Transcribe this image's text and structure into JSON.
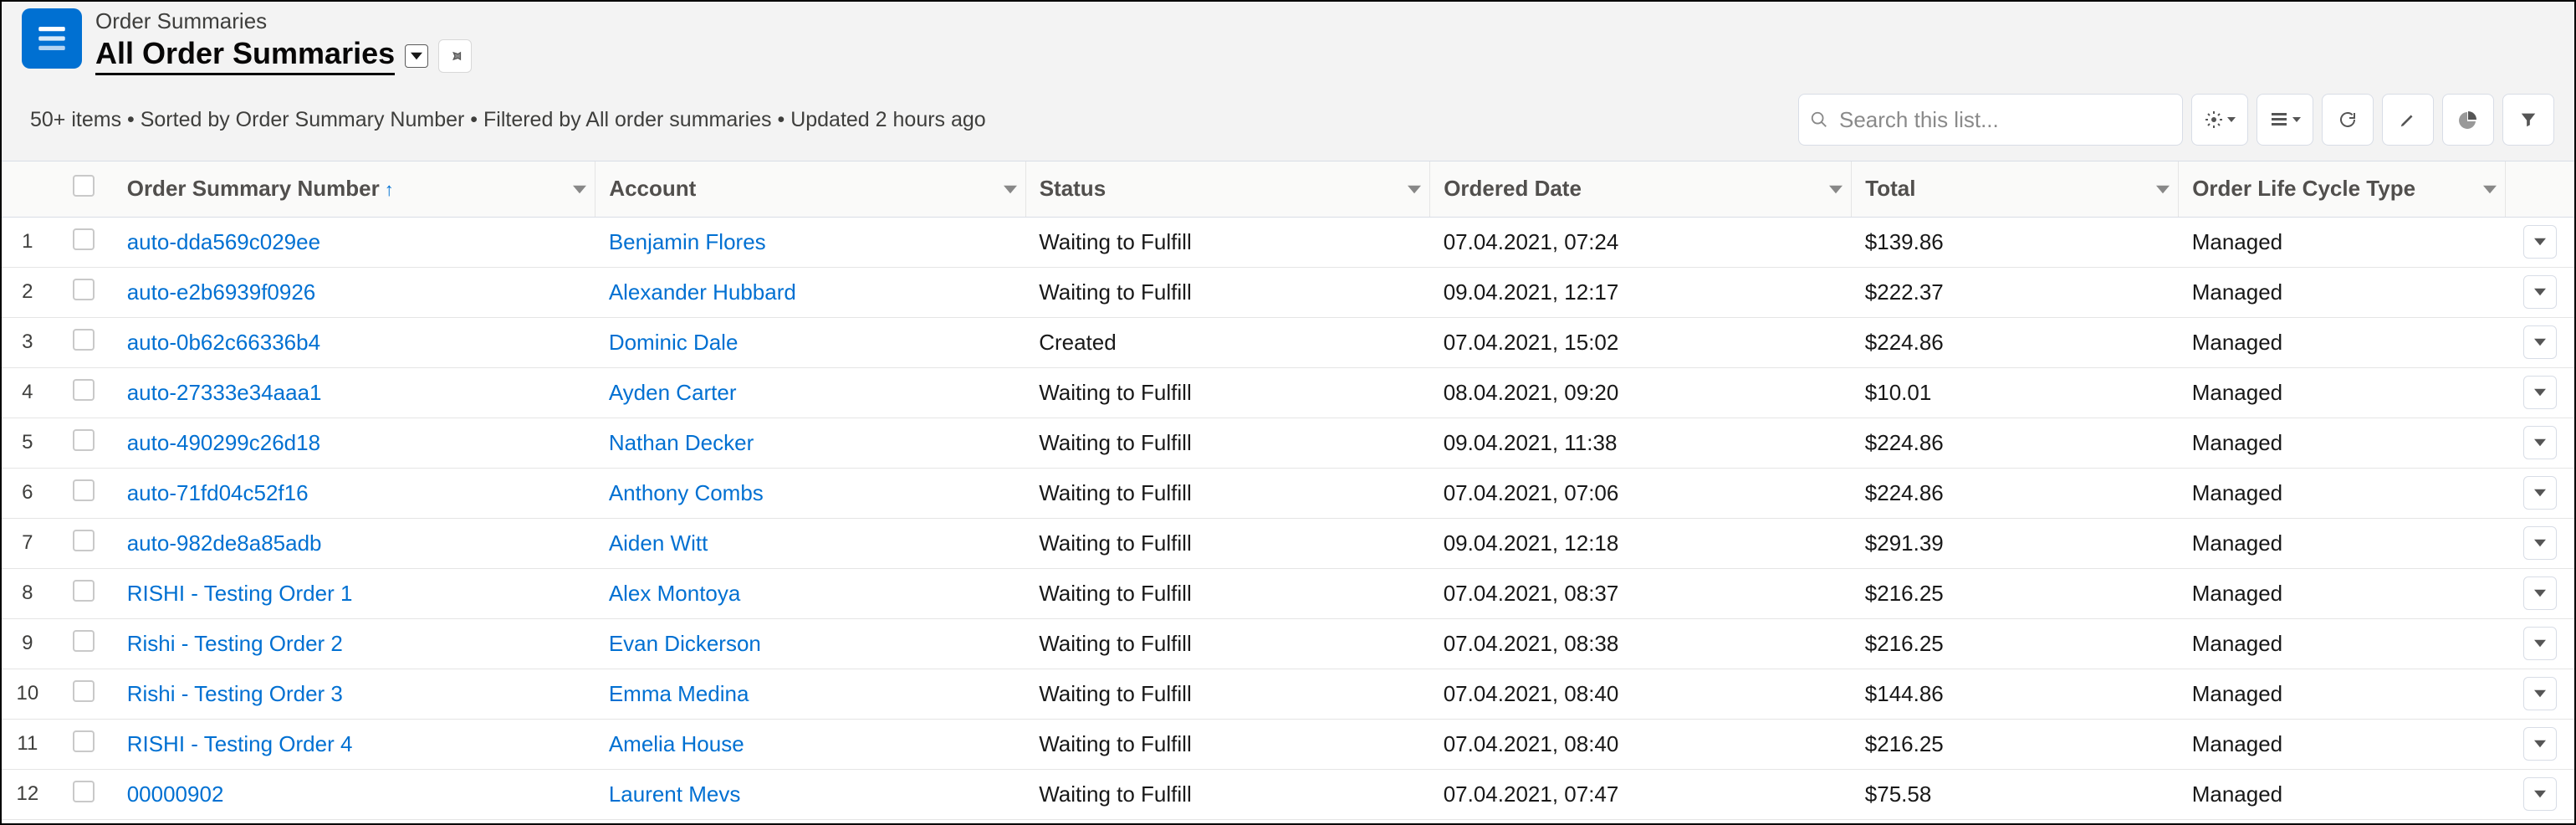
{
  "header": {
    "object_name": "Order Summaries",
    "view_name": "All Order Summaries",
    "meta": "50+ items • Sorted by Order Summary Number • Filtered by All order summaries • Updated 2 hours ago",
    "search_placeholder": "Search this list..."
  },
  "columns": {
    "order_summary_number": "Order Summary Number",
    "account": "Account",
    "status": "Status",
    "ordered_date": "Ordered Date",
    "total": "Total",
    "lifecycle": "Order Life Cycle Type"
  },
  "rows": [
    {
      "idx": "1",
      "osn": "auto-dda569c029ee",
      "account": "Benjamin Flores",
      "status": "Waiting to Fulfill",
      "date": "07.04.2021, 07:24",
      "total": "$139.86",
      "life": "Managed"
    },
    {
      "idx": "2",
      "osn": "auto-e2b6939f0926",
      "account": "Alexander Hubbard",
      "status": "Waiting to Fulfill",
      "date": "09.04.2021, 12:17",
      "total": "$222.37",
      "life": "Managed"
    },
    {
      "idx": "3",
      "osn": "auto-0b62c66336b4",
      "account": "Dominic Dale",
      "status": "Created",
      "date": "07.04.2021, 15:02",
      "total": "$224.86",
      "life": "Managed"
    },
    {
      "idx": "4",
      "osn": "auto-27333e34aaa1",
      "account": "Ayden Carter",
      "status": "Waiting to Fulfill",
      "date": "08.04.2021, 09:20",
      "total": "$10.01",
      "life": "Managed"
    },
    {
      "idx": "5",
      "osn": "auto-490299c26d18",
      "account": "Nathan Decker",
      "status": "Waiting to Fulfill",
      "date": "09.04.2021, 11:38",
      "total": "$224.86",
      "life": "Managed"
    },
    {
      "idx": "6",
      "osn": "auto-71fd04c52f16",
      "account": "Anthony Combs",
      "status": "Waiting to Fulfill",
      "date": "07.04.2021, 07:06",
      "total": "$224.86",
      "life": "Managed"
    },
    {
      "idx": "7",
      "osn": "auto-982de8a85adb",
      "account": "Aiden Witt",
      "status": "Waiting to Fulfill",
      "date": "09.04.2021, 12:18",
      "total": "$291.39",
      "life": "Managed"
    },
    {
      "idx": "8",
      "osn": "RISHI - Testing Order 1",
      "account": "Alex Montoya",
      "status": "Waiting to Fulfill",
      "date": "07.04.2021, 08:37",
      "total": "$216.25",
      "life": "Managed"
    },
    {
      "idx": "9",
      "osn": "Rishi - Testing Order 2",
      "account": "Evan Dickerson",
      "status": "Waiting to Fulfill",
      "date": "07.04.2021, 08:38",
      "total": "$216.25",
      "life": "Managed"
    },
    {
      "idx": "10",
      "osn": "Rishi - Testing Order 3",
      "account": "Emma Medina",
      "status": "Waiting to Fulfill",
      "date": "07.04.2021, 08:40",
      "total": "$144.86",
      "life": "Managed"
    },
    {
      "idx": "11",
      "osn": "RISHI - Testing Order 4",
      "account": "Amelia House",
      "status": "Waiting to Fulfill",
      "date": "07.04.2021, 08:40",
      "total": "$216.25",
      "life": "Managed"
    },
    {
      "idx": "12",
      "osn": "00000902",
      "account": "Laurent Mevs",
      "status": "Waiting to Fulfill",
      "date": "07.04.2021, 07:47",
      "total": "$75.58",
      "life": "Managed"
    }
  ]
}
